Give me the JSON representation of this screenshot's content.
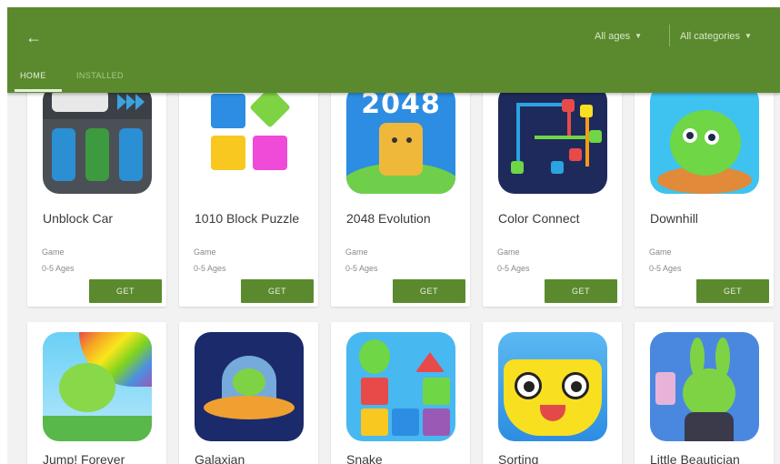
{
  "appbar": {
    "back_label": "Back",
    "filters": {
      "ages": "All ages",
      "categories": "All categories"
    },
    "tabs": [
      {
        "label": "HOME",
        "active": true
      },
      {
        "label": "INSTALLED",
        "active": false
      }
    ],
    "color": "#5b8a2e"
  },
  "apps": [
    {
      "title": "Unblock Car",
      "category": "Game",
      "ages": "0-5 Ages",
      "button": "GET",
      "icon": "unblock-car-icon"
    },
    {
      "title": "1010 Block Puzzle",
      "category": "Game",
      "ages": "0-5 Ages",
      "button": "GET",
      "icon": "block-puzzle-icon"
    },
    {
      "title": "2048 Evolution",
      "category": "Game",
      "ages": "0-5 Ages",
      "button": "GET",
      "icon": "2048-evolution-icon",
      "icon_text": "2048"
    },
    {
      "title": "Color Connect",
      "category": "Game",
      "ages": "0-5 Ages",
      "button": "GET",
      "icon": "color-connect-icon"
    },
    {
      "title": "Downhill",
      "category": "Game",
      "ages": "0-5 Ages",
      "button": "GET",
      "icon": "downhill-icon"
    },
    {
      "title": "Jump! Forever",
      "icon": "jump-forever-icon"
    },
    {
      "title": "Galaxian",
      "icon": "galaxian-icon"
    },
    {
      "title": "Snake",
      "icon": "snake-icon"
    },
    {
      "title": "Sorting",
      "icon": "sorting-icon"
    },
    {
      "title": "Little Beautician",
      "icon": "little-beautician-icon"
    }
  ]
}
